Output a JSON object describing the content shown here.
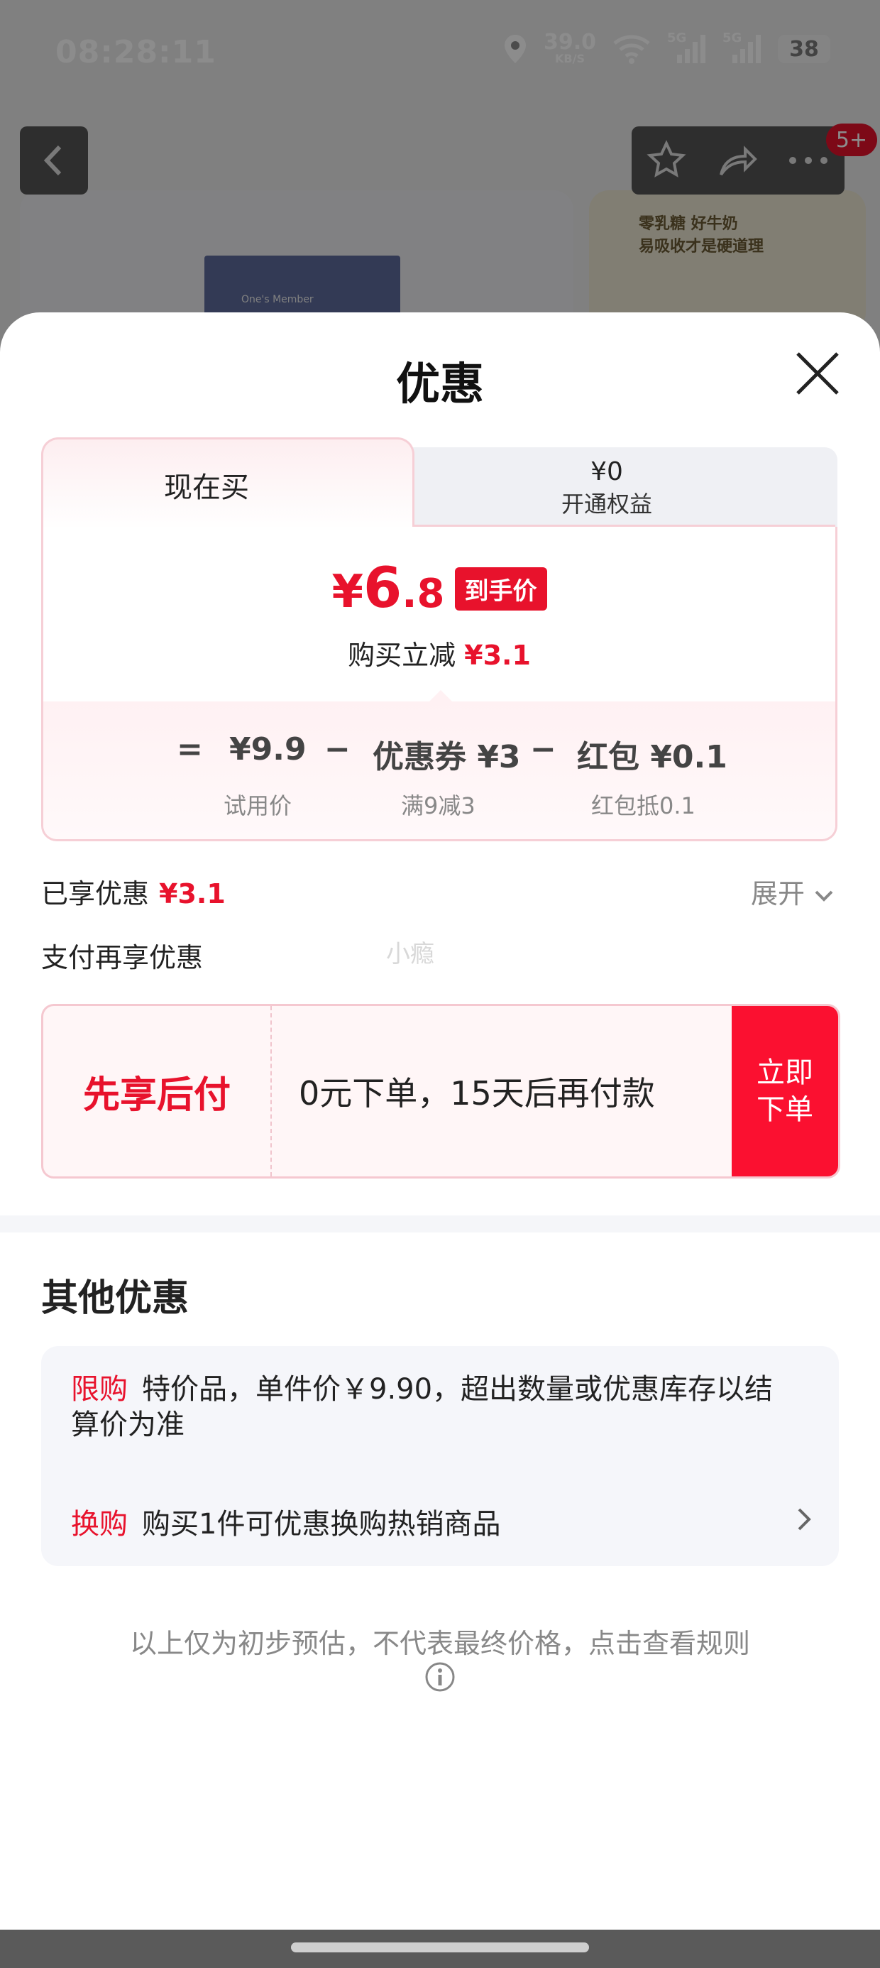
{
  "status_bar": {
    "time": "08:28:11",
    "speed_value": "39.0",
    "speed_unit": "KB/S",
    "network_1": "5G",
    "network_2": "5G",
    "battery": "38"
  },
  "background_page": {
    "cart_badge": "5+",
    "product_label": "One's Member",
    "promo_text_1": "零乳糖 好牛奶",
    "promo_text_2": "易吸收才是硬道理"
  },
  "sheet": {
    "title": "优惠",
    "tabs": {
      "now": "现在买",
      "member_price": "¥0",
      "member_label": "开通权益"
    },
    "final_price": {
      "yen": "¥",
      "integer": "6",
      "decimal": ".8",
      "tag": "到手价"
    },
    "instant_saving": {
      "label": "购买立减",
      "amount": "¥3.1"
    },
    "breakdown": {
      "equals": "=",
      "trial_price": "¥9.9",
      "trial_label": "试用价",
      "minus_1": "−",
      "coupon": "优惠券 ¥3",
      "coupon_label": "满9减3",
      "minus_2": "−",
      "redpacket": "红包 ¥0.1",
      "redpacket_label": "红包抵0.1"
    },
    "enjoyed": {
      "label": "已享优惠",
      "amount": "¥3.1",
      "expand": "展开"
    },
    "pay_more_label": "支付再享优惠",
    "watermark": "小瘾",
    "pay_later": {
      "title": "先享后付",
      "desc": "0元下单，15天后再付款",
      "button_line1": "立即",
      "button_line2": "下单"
    },
    "other_title": "其他优惠",
    "other_items": [
      {
        "tag": "限购",
        "text": "特价品，单件价￥9.90，超出数量或优惠库存以结算价为准"
      },
      {
        "tag": "换购",
        "text": "购买1件可优惠换购热销商品"
      }
    ],
    "footnote": "以上仅为初步预估，不代表最终价格，点击查看规则"
  },
  "colors": {
    "accent_red": "#e8122c",
    "button_red": "#fb1030"
  }
}
